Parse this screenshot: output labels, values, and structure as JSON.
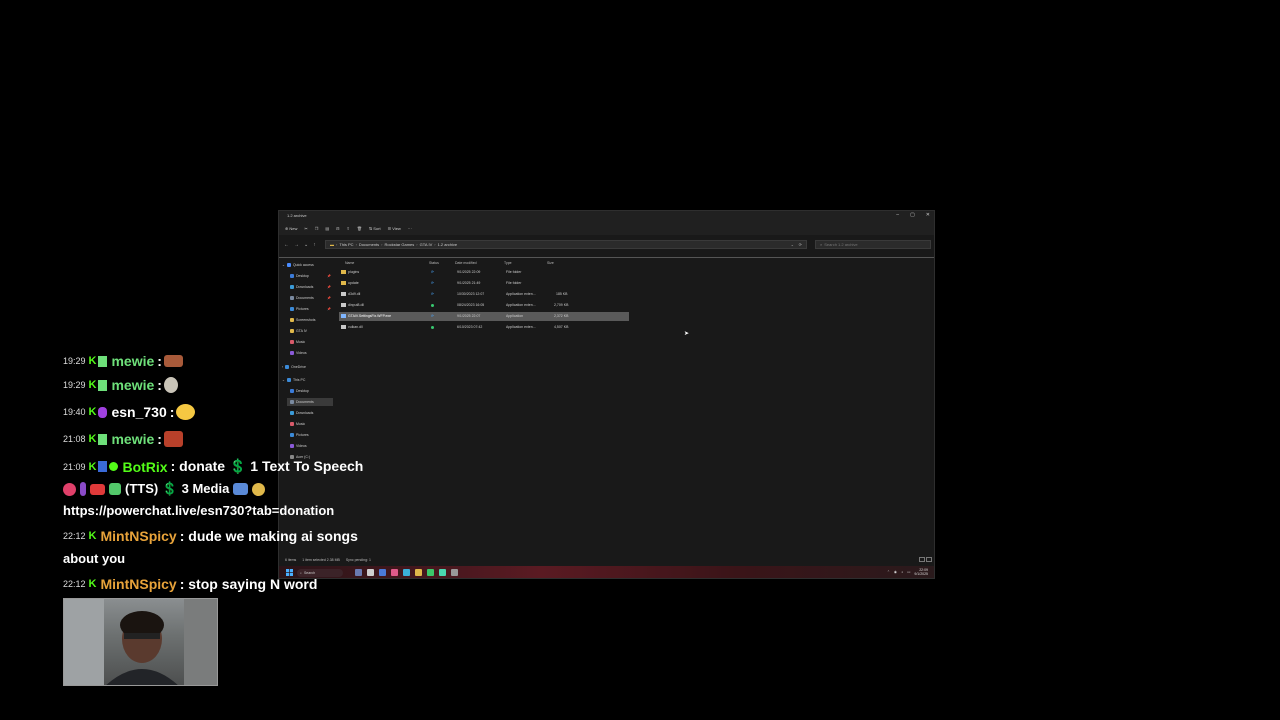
{
  "explorer": {
    "title": "1.2 archive",
    "toolbar": {
      "new": "New",
      "sort": "Sort",
      "view": "View",
      "more": "···"
    },
    "address": [
      "This PC",
      "Documents",
      "Rockstar Games",
      "GTA IV",
      "1.2 archive"
    ],
    "search_placeholder": "Search 1.2 archive",
    "columns": {
      "name": "Name",
      "status": "Status",
      "date": "Date modified",
      "type": "Type",
      "size": "Size"
    },
    "nav": [
      {
        "label": "Quick access",
        "color": "#4a8cff"
      },
      {
        "label": "Desktop",
        "color": "#3b7bd8"
      },
      {
        "label": "Downloads",
        "color": "#3b9bd8"
      },
      {
        "label": "Documents",
        "color": "#7a8aa0"
      },
      {
        "label": "Pictures",
        "color": "#3b8ad8"
      },
      {
        "label": "Screenshots",
        "color": "#e0b84a"
      },
      {
        "label": "GTA IV",
        "color": "#e0b84a"
      },
      {
        "label": "Music",
        "color": "#d85a6a"
      },
      {
        "label": "Videos",
        "color": "#8a5ad8"
      },
      {
        "label": "OneDrive",
        "color": "#3b8ad8"
      },
      {
        "label": "This PC",
        "color": "#3b8ad8"
      },
      {
        "label": "Desktop",
        "color": "#3b7bd8"
      },
      {
        "label": "Documents",
        "color": "#7a8aa0"
      },
      {
        "label": "Downloads",
        "color": "#3b9bd8"
      },
      {
        "label": "Music",
        "color": "#d85a6a"
      },
      {
        "label": "Pictures",
        "color": "#3b8ad8"
      },
      {
        "label": "Videos",
        "color": "#8a5ad8"
      },
      {
        "label": "Acer (C:)",
        "color": "#888888"
      }
    ],
    "files": [
      {
        "name": "plugins",
        "date": "9/1/2025 22:09",
        "type": "File folder",
        "size": "",
        "kind": "folder"
      },
      {
        "name": "update",
        "date": "9/1/2025 21:49",
        "type": "File folder",
        "size": "",
        "kind": "folder"
      },
      {
        "name": "d3d9.dll",
        "date": "10/30/2023 12:07",
        "type": "Application exten...",
        "size": "185 KB",
        "kind": "dll"
      },
      {
        "name": "dinput8.dll",
        "date": "08/24/2023 16:05",
        "type": "Application exten...",
        "size": "2,709 KB",
        "kind": "dll"
      },
      {
        "name": "GTAIV.SettingsFix.WFP.exe",
        "date": "9/1/2025 22:07",
        "type": "Application",
        "size": "2,372 KB",
        "kind": "exe"
      },
      {
        "name": "vulkan.dll",
        "date": "6/10/2023 07:42",
        "type": "Application exten...",
        "size": "4,507 KB",
        "kind": "dll"
      }
    ],
    "status": {
      "items": "6 items",
      "selected": "1 item selected  2.38 MB",
      "sync": "Sync pending: 1"
    },
    "taskbar": {
      "search": "Search",
      "time": "22:09",
      "date": "9/1/2025"
    }
  },
  "chat": [
    {
      "time": "19:29",
      "user": "mewie",
      "text": ":",
      "user_color": "#6ee07a"
    },
    {
      "time": "19:29",
      "user": "mewie",
      "text": ":",
      "user_color": "#6ee07a"
    },
    {
      "time": "19:40",
      "user": "esn_730",
      "text": ":",
      "user_color": "#ffffff"
    },
    {
      "time": "21:08",
      "user": "mewie",
      "text": ":",
      "user_color": "#6ee07a"
    },
    {
      "time": "21:09",
      "user": "BotRix",
      "text": ": donate  💲  1 Text To Speech",
      "user_color": "#53fc18"
    },
    {
      "time": "22:12",
      "user": "MintNSpicy",
      "text": ": dude we making ai songs",
      "user_color": "#e8a33a"
    },
    {
      "time": "22:12",
      "user": "MintNSpicy",
      "text": ": stop saying N word",
      "user_color": "#e8a33a"
    }
  ],
  "chat_cont": {
    "tts_line": "(TTS)  💲  3 Media",
    "link_line": "https://powerchat.live/esn730?tab=donation",
    "about_line": "about you"
  }
}
